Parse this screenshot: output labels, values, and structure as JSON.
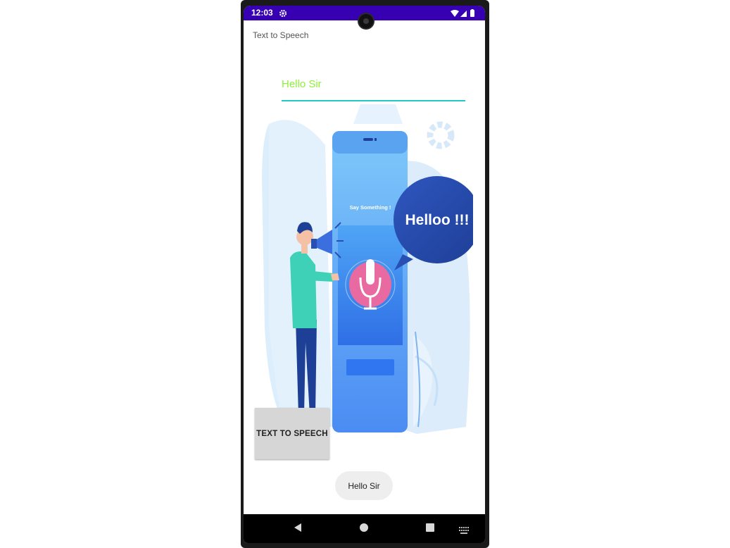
{
  "status_bar": {
    "time": "12:03",
    "background": "#3700b3",
    "icons": [
      "settings-icon",
      "wifi-icon",
      "signal-icon",
      "battery-icon"
    ]
  },
  "app": {
    "title": "Text to Speech"
  },
  "input": {
    "value": "Hello Sir",
    "text_color": "#8ef03a",
    "underline_color": "#26c6c6"
  },
  "illustration": {
    "phone_caption": "Say Something !",
    "bubble_text": "Helloo !!!",
    "icons": [
      "gear-icon",
      "megaphone-icon",
      "microphone-icon"
    ]
  },
  "button": {
    "label": "TEXT TO SPEECH"
  },
  "toast": {
    "message": "Hello Sir"
  },
  "nav_bar": {
    "buttons": [
      "back-button",
      "home-button",
      "recents-button",
      "keyboard-icon"
    ]
  }
}
